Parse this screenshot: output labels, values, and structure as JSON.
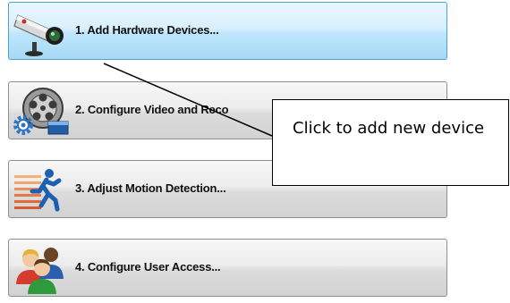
{
  "steps": [
    {
      "label": "1. Add Hardware Devices...",
      "icon": "security-camera-icon",
      "state": "highlighted"
    },
    {
      "label": "2. Configure Video and Reco",
      "icon": "film-reel-gear-icon",
      "state": "normal"
    },
    {
      "label": "3. Adjust Motion Detection...",
      "icon": "running-person-icon",
      "state": "normal"
    },
    {
      "label": "4. Configure User Access...",
      "icon": "users-group-icon",
      "state": "normal"
    }
  ],
  "callout": {
    "text": "Click to add new device"
  },
  "colors": {
    "highlight_border": "#4aa3d9",
    "highlight_fill": "#bee6fd",
    "button_border": "#8f8f8f",
    "button_fill": "#dcdcdc"
  }
}
